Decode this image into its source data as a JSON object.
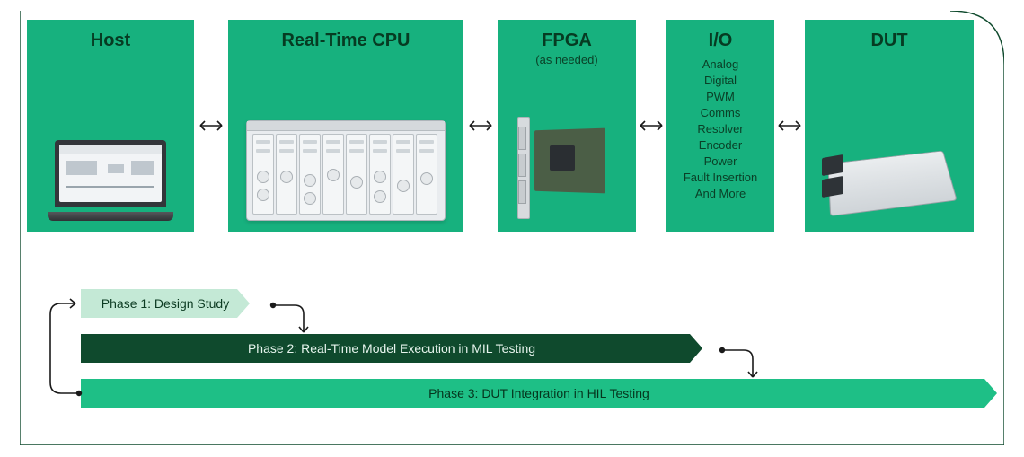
{
  "panels": {
    "host": {
      "title": "Host"
    },
    "rt": {
      "title": "Real-Time CPU"
    },
    "fpga": {
      "title": "FPGA",
      "subtitle": "(as needed)"
    },
    "io": {
      "title": "I/O",
      "items": [
        "Analog",
        "Digital",
        "PWM",
        "Comms",
        "Resolver",
        "Encoder",
        "Power",
        "Fault Insertion",
        "And More"
      ]
    },
    "dut": {
      "title": "DUT"
    }
  },
  "phases": {
    "p1": "Phase 1: Design Study",
    "p2": "Phase 2: Real-Time Model Execution in MIL Testing",
    "p3": "Phase 3: DUT Integration in HIL Testing"
  },
  "colors": {
    "panel": "#17B17E",
    "phase1": "#C4E9D6",
    "phase2": "#0F4A2D",
    "phase3": "#1EBF86",
    "frame": "#0F4A2D"
  }
}
